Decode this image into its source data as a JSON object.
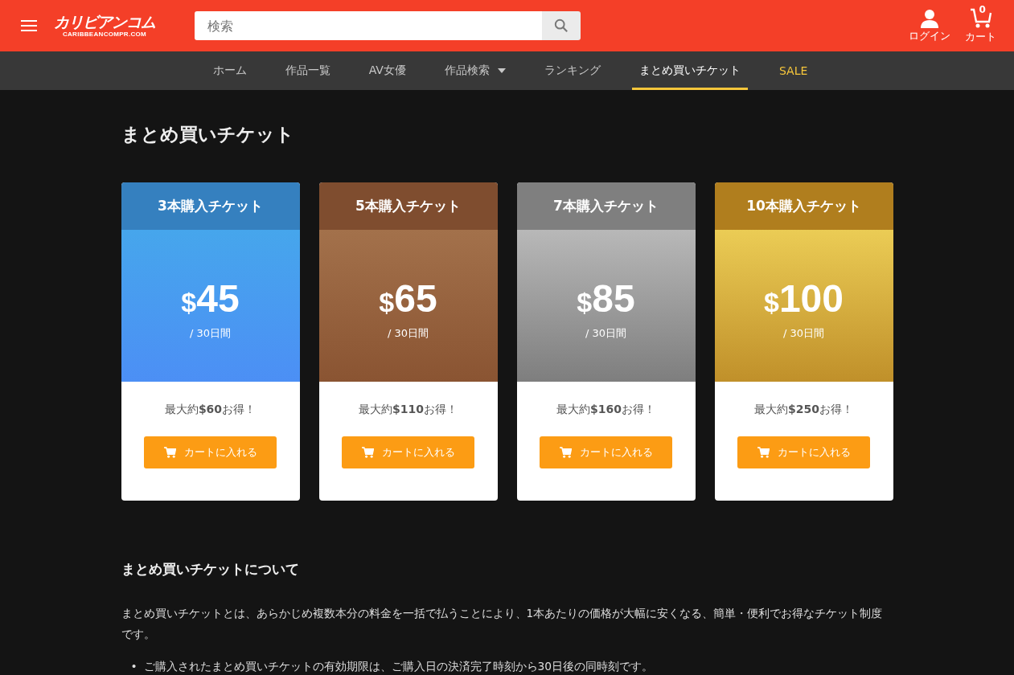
{
  "header": {
    "logo": {
      "title": "カリビアンコム",
      "subtitle": "CARIBBEANCOMPR.COM"
    },
    "search": {
      "placeholder": "検索"
    },
    "login": {
      "label": "ログイン"
    },
    "cart": {
      "label": "カート",
      "count": "0"
    }
  },
  "nav": [
    {
      "label": "ホーム",
      "kind": "link",
      "selected": false
    },
    {
      "label": "作品一覧",
      "kind": "link",
      "selected": false
    },
    {
      "label": "AV女優",
      "kind": "link",
      "selected": false
    },
    {
      "label": "作品検索",
      "kind": "dropdown",
      "selected": false
    },
    {
      "label": "ランキング",
      "kind": "link",
      "selected": false
    },
    {
      "label": "まとめ買いチケット",
      "kind": "link",
      "selected": true
    },
    {
      "label": "SALE",
      "kind": "sale",
      "selected": false
    }
  ],
  "page_title": "まとめ買いチケット",
  "tickets": [
    {
      "title": "3本購入チケット",
      "kind": "blue",
      "currency": "$",
      "price": "45",
      "period": "/ 30日間",
      "saving": "最大約**$60**お得！",
      "button": "カートに入れる"
    },
    {
      "title": "5本購入チケット",
      "kind": "bronze",
      "currency": "$",
      "price": "65",
      "period": "/ 30日間",
      "saving": "最大約**$110**お得！",
      "button": "カートに入れる"
    },
    {
      "title": "7本購入チケット",
      "kind": "silver",
      "currency": "$",
      "price": "85",
      "period": "/ 30日間",
      "saving": "最大約**$160**お得！",
      "button": "カートに入れる"
    },
    {
      "title": "10本購入チケット",
      "kind": "gold",
      "currency": "$",
      "price": "100",
      "period": "/ 30日間",
      "saving": "最大約**$250**お得！",
      "button": "カートに入れる"
    }
  ],
  "about": {
    "heading": "まとめ買いチケットについて",
    "paragraph": "まとめ買いチケットとは、あらかじめ複数本分の料金を一括で払うことにより、1本あたりの価格が大幅に安くなる、簡単・便利でお得なチケット制度です。",
    "bullets": [
      {
        "marker": "•",
        "text": "ご購入されたまとめ買いチケットの有効期限は、ご購入日の決済完了時刻から30日後の同時刻です。"
      }
    ]
  }
}
